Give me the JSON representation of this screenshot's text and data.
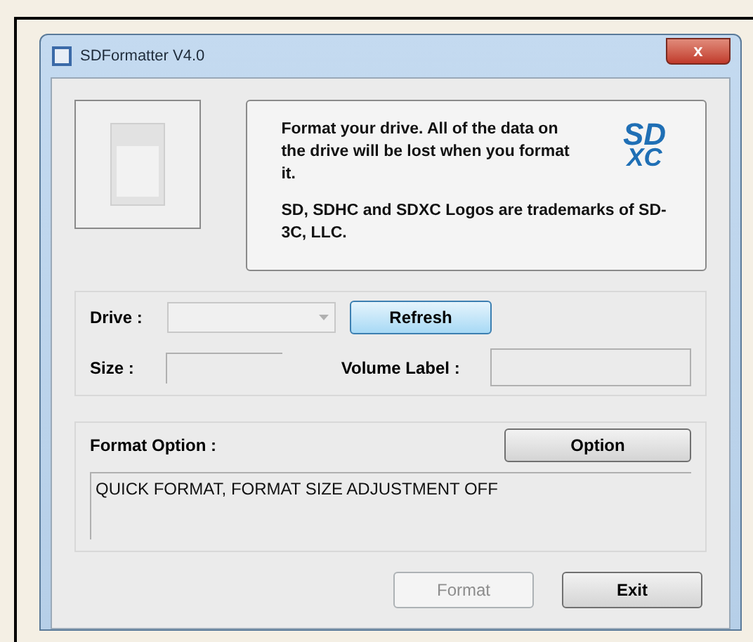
{
  "window": {
    "title": "SDFormatter V4.0",
    "close": "x"
  },
  "message": {
    "text": "Format your drive. All of the data on the drive will be lost when you format it.",
    "trademark": "SD, SDHC and SDXC Logos are trademarks of SD-3C, LLC.",
    "logo_top": "SD",
    "logo_bottom": "XC"
  },
  "drive": {
    "label": "Drive :",
    "disabled": true
  },
  "refresh_button": {
    "label": "Refresh",
    "focused": true
  },
  "size": {
    "label": "Size  :"
  },
  "volume_label": {
    "label": "Volume Label  :"
  },
  "format_option": {
    "label": "Format Option :",
    "button": "Option",
    "value": "QUICK FORMAT, FORMAT SIZE ADJUSTMENT OFF"
  },
  "buttons": [
    {
      "label": "Format",
      "disabled": true
    },
    {
      "label": "Exit",
      "disabled": false
    }
  ]
}
